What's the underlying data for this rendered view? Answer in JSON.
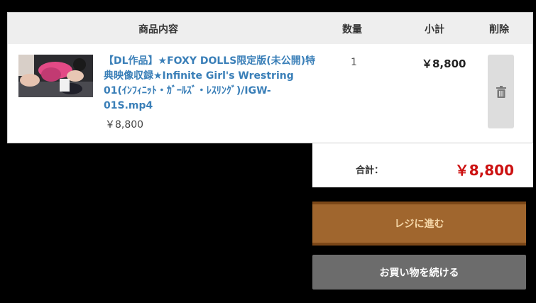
{
  "cart": {
    "headers": {
      "product": "商品内容",
      "quantity": "数量",
      "subtotal": "小計",
      "delete": "削除"
    },
    "items": [
      {
        "title": "【DL作品】★FOXY DOLLS限定版(未公開)特典映像収録★Infinite Girl's Wrestring 01(ｲﾝﾌｨﾆｯﾄ・ｶﾞｰﾙｽﾞ・ﾚｽﾘﾝｸﾞ)/IGW-01S.mp4",
        "unit_price": "￥8,800",
        "quantity": "1",
        "line_subtotal": "￥8,800",
        "delete_icon": "trash-icon"
      }
    ]
  },
  "summary": {
    "total_label": "合計：",
    "total_value": "￥8,800"
  },
  "actions": {
    "checkout_label": "レジに進む",
    "continue_label": "お買い物を続ける"
  },
  "colors": {
    "link": "#3a7fb8",
    "total": "#cc1111",
    "checkout_bg": "#a0662e",
    "checkout_text": "#f5d7a8",
    "continue_bg": "#6c6c6c"
  }
}
